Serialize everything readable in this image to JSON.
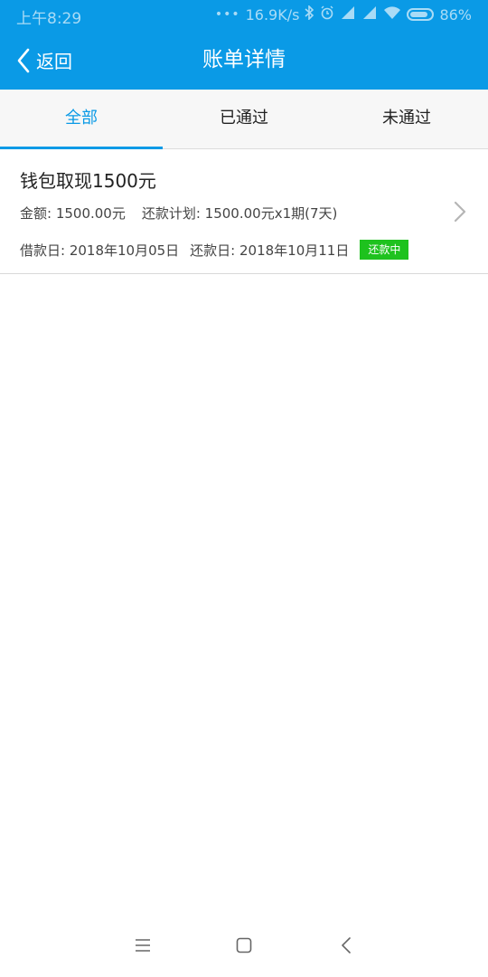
{
  "status_bar": {
    "time": "上午8:29",
    "net_speed": "16.9K/s",
    "battery": "86%",
    "dots": "•••"
  },
  "header": {
    "back_label": "返回",
    "title": "账单详情"
  },
  "tabs": [
    {
      "label": "全部",
      "active": true
    },
    {
      "label": "已通过",
      "active": false
    },
    {
      "label": "未通过",
      "active": false
    }
  ],
  "bill": {
    "title": "钱包取现1500元",
    "amount_text": "金额: 1500.00元",
    "plan_text": "还款计划: 1500.00元x1期(7天)",
    "borrow_date_text": "借款日: 2018年10月05日",
    "repay_date_text": "还款日: 2018年10月11日",
    "status_badge": "还款中",
    "status_color": "#1ec21e"
  },
  "theme": {
    "primary": "#0a9ae6"
  },
  "icons": {
    "back": "chevron-left-icon",
    "row_arrow": "chevron-right-icon",
    "nav_menu": "menu-icon",
    "nav_home": "square-home-icon",
    "nav_back": "back-arrow-icon"
  }
}
